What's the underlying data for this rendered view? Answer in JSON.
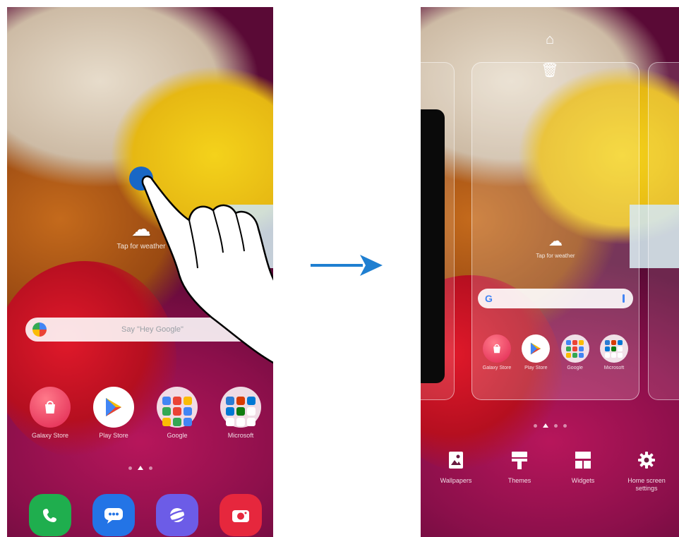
{
  "left_screen": {
    "weather": {
      "icon": "cloud-plus-icon",
      "label": "Tap for weather"
    },
    "search": {
      "placeholder": "Say \"Hey Google\""
    },
    "apps": [
      {
        "name": "Galaxy Store",
        "icon": "shopping-bag-icon"
      },
      {
        "name": "Play Store",
        "icon": "play-triangle-icon"
      },
      {
        "name": "Google",
        "icon": "folder-icon"
      },
      {
        "name": "Microsoft",
        "icon": "folder-icon"
      }
    ],
    "dock": [
      {
        "name": "Phone",
        "icon": "phone-icon"
      },
      {
        "name": "Messages",
        "icon": "chat-icon"
      },
      {
        "name": "Internet",
        "icon": "planet-icon"
      },
      {
        "name": "Camera",
        "icon": "camera-icon"
      }
    ]
  },
  "right_screen": {
    "top_actions": [
      {
        "name": "home",
        "icon": "home-icon"
      },
      {
        "name": "delete",
        "icon": "trash-icon"
      }
    ],
    "weather_label": "Tap for weather",
    "apps": [
      {
        "name": "Galaxy Store"
      },
      {
        "name": "Play Store"
      },
      {
        "name": "Google"
      },
      {
        "name": "Microsoft"
      }
    ],
    "menu": [
      {
        "label": "Wallpapers",
        "icon": "image-icon"
      },
      {
        "label": "Themes",
        "icon": "paint-roller-icon"
      },
      {
        "label": "Widgets",
        "icon": "widgets-icon"
      },
      {
        "label": "Home screen settings",
        "icon": "gear-icon"
      }
    ]
  },
  "colors": {
    "tap_marker": "#1967c5",
    "arrow": "#1f7fd1"
  }
}
